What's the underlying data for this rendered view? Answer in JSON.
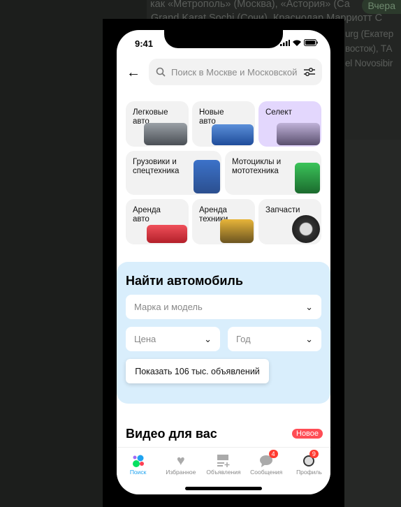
{
  "background": {
    "lines": [
      "как «Метрополь» (Москва), «Астория» (Са",
      "Grand Karat Sochi (Сочи), Краснодар Марриотт С",
      "urg (Екатер",
      "восток), ТА",
      "el Novosibir"
    ],
    "badge": "Вчера"
  },
  "status": {
    "time": "9:41"
  },
  "search": {
    "placeholder": "Поиск в Москве и Московской области"
  },
  "categories": [
    {
      "label": "Легковые авто"
    },
    {
      "label": "Новые авто"
    },
    {
      "label": "Селект",
      "color": "#e3d7fd"
    },
    {
      "label": "Грузовики и спецтехника"
    },
    {
      "label": "Мотоциклы и мототехника"
    },
    {
      "label": "Аренда авто"
    },
    {
      "label": "Аренда техники"
    },
    {
      "label": "Запчасти"
    }
  ],
  "find": {
    "title": "Найти автомобиль",
    "make_model": "Марка и модель",
    "price": "Цена",
    "year": "Год",
    "show_button": "Показать 106 тыс. объявлений"
  },
  "video": {
    "title": "Видео для вас",
    "badge": "Новое"
  },
  "tabs": [
    {
      "label": "Поиск",
      "active": true
    },
    {
      "label": "Избранное"
    },
    {
      "label": "Объявления"
    },
    {
      "label": "Сообщения",
      "count": "4"
    },
    {
      "label": "Профиль",
      "count": "9"
    }
  ],
  "colors": {
    "accent": "#1fa3f0",
    "find_bg": "#d9eefc",
    "badge": "#ff4d55"
  }
}
